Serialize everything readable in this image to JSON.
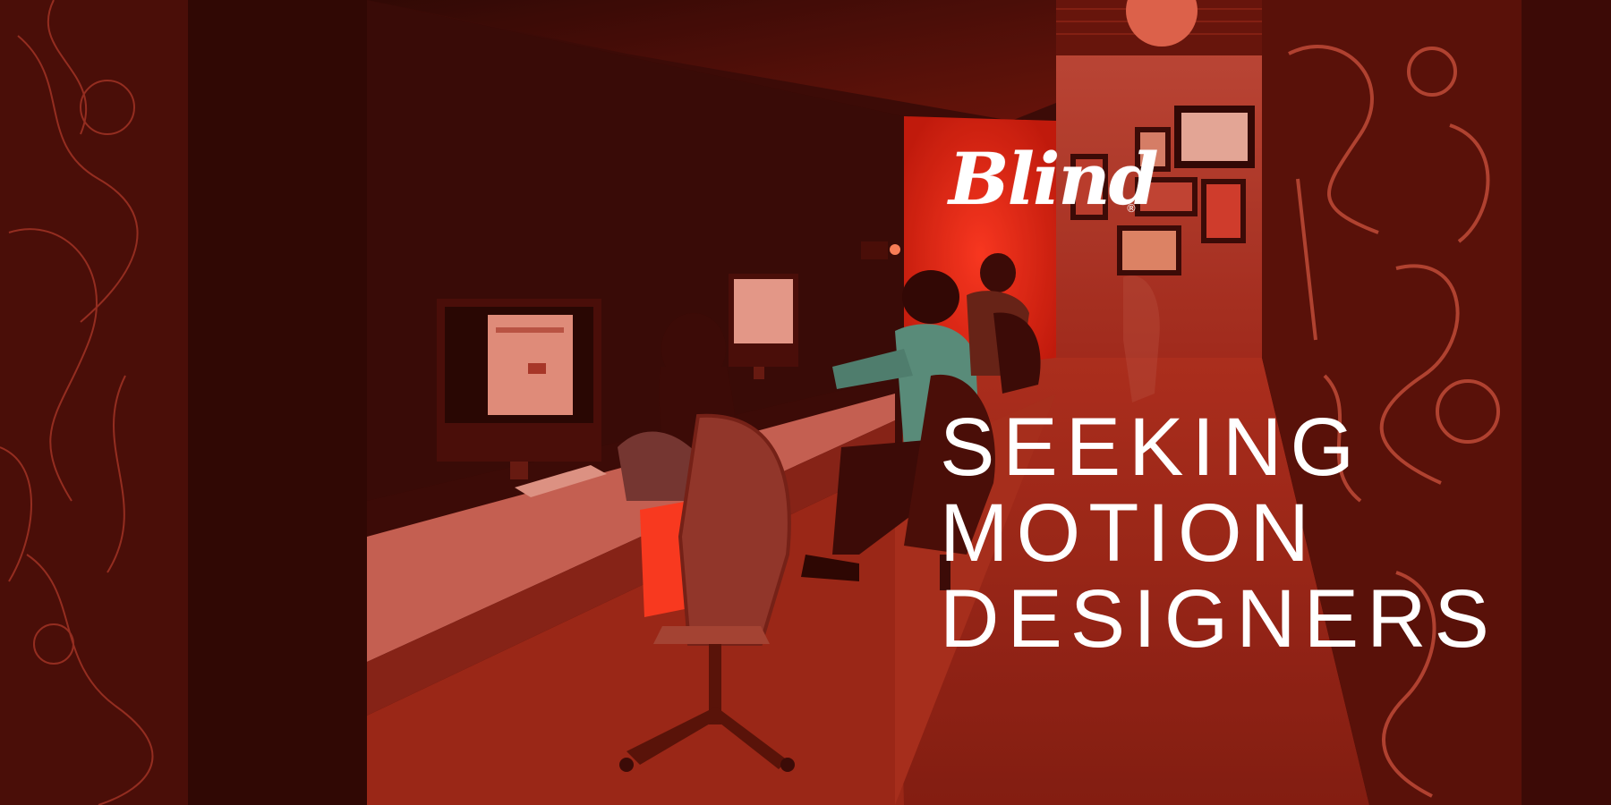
{
  "brand": {
    "logo_text": "Blind",
    "registered_mark": "®"
  },
  "headline": {
    "line1": "SEEKING",
    "line2": "MOTION",
    "line3": "DESIGNERS"
  },
  "colors": {
    "tint": "#c81e0f",
    "shadow": "#1a0503",
    "text": "#ffffff"
  }
}
